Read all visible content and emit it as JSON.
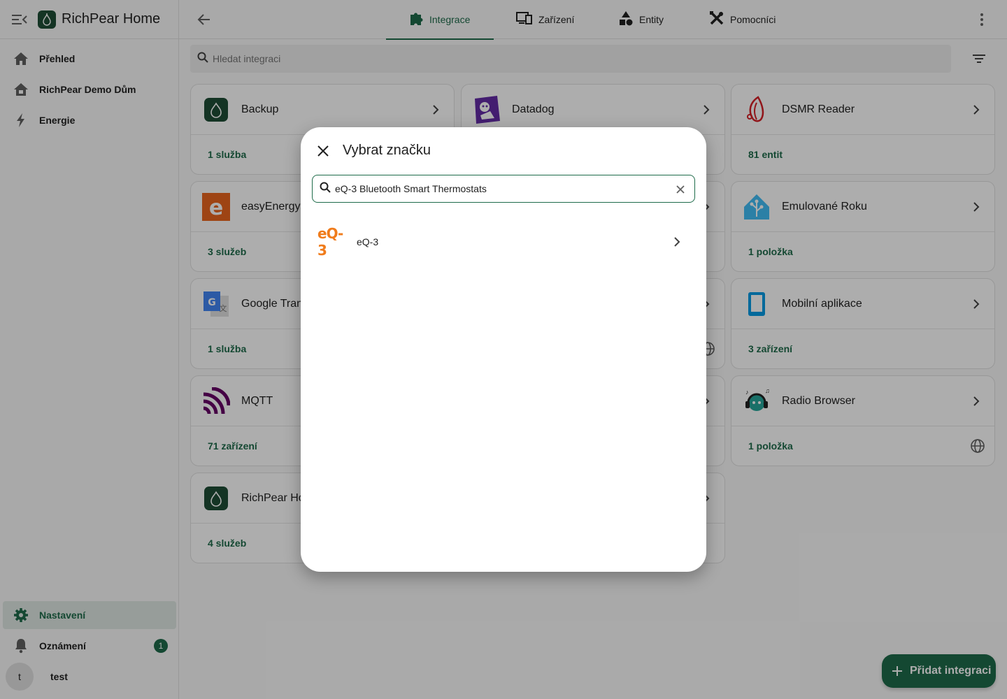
{
  "app": {
    "title": "RichPear Home"
  },
  "sidebar": {
    "items": [
      {
        "label": "Přehled",
        "icon": "home-icon"
      },
      {
        "label": "RichPear Demo Dům",
        "icon": "home-outline-icon"
      },
      {
        "label": "Energie",
        "icon": "lightning-icon"
      }
    ],
    "bottom": [
      {
        "label": "Nastavení",
        "icon": "gear-icon",
        "active": true
      },
      {
        "label": "Oznámení",
        "icon": "bell-icon",
        "badge": "1"
      },
      {
        "label": "test",
        "avatar": "t"
      }
    ]
  },
  "topbar": {
    "tabs": [
      {
        "label": "Integrace",
        "icon": "puzzle-icon",
        "active": true
      },
      {
        "label": "Zařízení",
        "icon": "devices-icon"
      },
      {
        "label": "Entity",
        "icon": "shapes-icon"
      },
      {
        "label": "Pomocníci",
        "icon": "tools-icon"
      }
    ]
  },
  "search": {
    "placeholder": "Hledat integraci"
  },
  "cards": [
    {
      "name": "Backup",
      "stat": "1 služba"
    },
    {
      "name": "Datadog",
      "stat": ""
    },
    {
      "name": "DSMR Reader",
      "stat": "81 entit"
    },
    {
      "name": "easyEnergy",
      "stat": "3 služeb"
    },
    {
      "name": "",
      "stat": ""
    },
    {
      "name": "Emulované Roku",
      "stat": "1 položka"
    },
    {
      "name": "Google Tran",
      "stat": "1 služba"
    },
    {
      "name": "",
      "stat": ""
    },
    {
      "name": "Mobilní aplikace",
      "stat": "3 zařízení"
    },
    {
      "name": "MQTT",
      "stat": "71 zařízení"
    },
    {
      "name": "",
      "stat": ""
    },
    {
      "name": "Radio Browser",
      "stat": "1 položka"
    },
    {
      "name": "RichPear Ho",
      "stat": "4 služeb"
    },
    {
      "name": "",
      "stat": ""
    }
  ],
  "dialog": {
    "title": "Vybrat značku",
    "search_value": "eQ-3 Bluetooth Smart Thermostats",
    "results": [
      {
        "logo_text": "eQ-3",
        "name": "eQ-3"
      }
    ]
  },
  "fab": {
    "label": "Přidat integraci"
  },
  "colors": {
    "primary": "#1e6b4a",
    "eq3_orange": "#f07c1c",
    "mqtt_purple": "#660066",
    "easyenergy_orange": "#e9651e",
    "dsmr_red": "#d62027",
    "roku_blue": "#41bdf5",
    "mobile_blue": "#039be5"
  }
}
